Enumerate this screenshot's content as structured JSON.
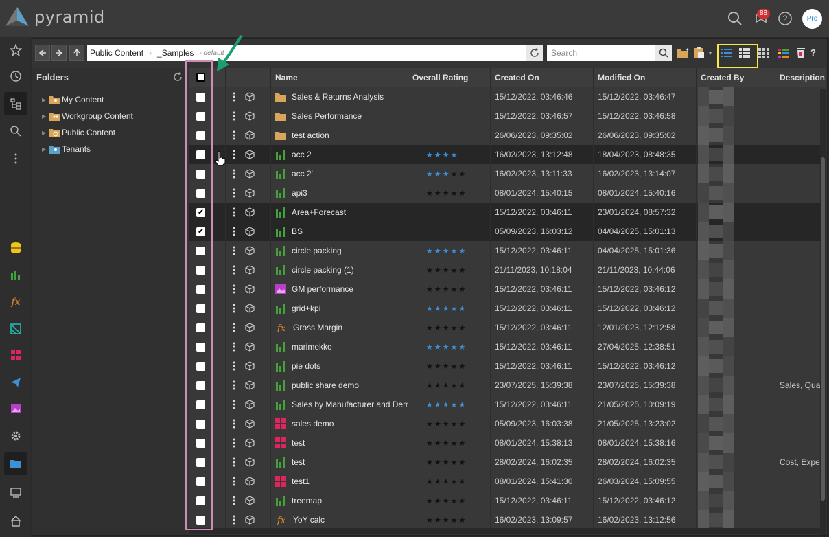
{
  "app": {
    "brand": "pyramid",
    "notification_count": "88",
    "avatar_label": "Pro"
  },
  "toolbar": {
    "path_root": "Public Content",
    "path_current": "_Samples",
    "path_suffix": "- default",
    "search_placeholder": "Search"
  },
  "folders": {
    "title": "Folders",
    "items": [
      {
        "label": "My Content"
      },
      {
        "label": "Workgroup Content"
      },
      {
        "label": "Public Content"
      },
      {
        "label": "Tenants"
      }
    ]
  },
  "grid": {
    "headers": {
      "name": "Name",
      "rating": "Overall Rating",
      "created": "Created On",
      "modified": "Modified On",
      "created_by": "Created By",
      "description": "Description"
    },
    "rows": [
      {
        "icon": "folder",
        "name": "Sales & Returns Analysis",
        "rating": null,
        "created": "15/12/2022, 03:46:46",
        "modified": "15/12/2022, 03:46:47",
        "description": "",
        "checked": false,
        "selected": false
      },
      {
        "icon": "folder",
        "name": "Sales Performance",
        "rating": null,
        "created": "15/12/2022, 03:46:57",
        "modified": "15/12/2022, 03:46:58",
        "description": "",
        "checked": false,
        "selected": false
      },
      {
        "icon": "folder",
        "name": "test action",
        "rating": null,
        "created": "26/06/2023, 09:35:02",
        "modified": "26/06/2023, 09:35:02",
        "description": "",
        "checked": false,
        "selected": false
      },
      {
        "icon": "chart",
        "name": "acc 2",
        "rating": 4,
        "max": 4,
        "created": "16/02/2023, 13:12:48",
        "modified": "18/04/2023, 08:48:35",
        "description": "",
        "checked": false,
        "selected": true
      },
      {
        "icon": "chart",
        "name": "acc 2'",
        "rating": 3,
        "max": 5,
        "created": "16/02/2023, 13:11:33",
        "modified": "16/02/2023, 13:14:07",
        "description": "",
        "checked": false,
        "selected": false
      },
      {
        "icon": "chart",
        "name": "api3",
        "rating": 0,
        "max": 5,
        "created": "08/01/2024, 15:40:15",
        "modified": "08/01/2024, 15:40:16",
        "description": "",
        "checked": false,
        "selected": false
      },
      {
        "icon": "chart",
        "name": "Area+Forecast",
        "rating": null,
        "created": "15/12/2022, 03:46:11",
        "modified": "23/01/2024, 08:57:32",
        "description": "",
        "checked": true,
        "selected": true
      },
      {
        "icon": "chart",
        "name": "BS",
        "rating": null,
        "created": "05/09/2023, 16:03:12",
        "modified": "04/04/2025, 15:01:13",
        "description": "",
        "checked": true,
        "selected": true
      },
      {
        "icon": "chart",
        "name": "circle packing",
        "rating": 5,
        "max": 5,
        "created": "15/12/2022, 03:46:11",
        "modified": "04/04/2025, 15:01:36",
        "description": "",
        "checked": false,
        "selected": false
      },
      {
        "icon": "chart",
        "name": "circle packing (1)",
        "rating": 0,
        "max": 5,
        "created": "21/11/2023, 10:18:04",
        "modified": "21/11/2023, 10:44:06",
        "description": "",
        "checked": false,
        "selected": false
      },
      {
        "icon": "image",
        "name": "GM performance",
        "rating": 0,
        "max": 5,
        "created": "15/12/2022, 03:46:11",
        "modified": "15/12/2022, 03:46:12",
        "description": "",
        "checked": false,
        "selected": false
      },
      {
        "icon": "chart",
        "name": "grid+kpi",
        "rating": 5,
        "max": 5,
        "created": "15/12/2022, 03:46:11",
        "modified": "15/12/2022, 03:46:12",
        "description": "",
        "checked": false,
        "selected": false
      },
      {
        "icon": "fx",
        "name": "Gross Margin",
        "rating": 0,
        "max": 5,
        "created": "15/12/2022, 03:46:11",
        "modified": "12/01/2023, 12:12:58",
        "description": "",
        "checked": false,
        "selected": false
      },
      {
        "icon": "chart",
        "name": "marimekko",
        "rating": 5,
        "max": 5,
        "created": "15/12/2022, 03:46:11",
        "modified": "27/04/2025, 12:38:51",
        "description": "",
        "checked": false,
        "selected": false
      },
      {
        "icon": "chart",
        "name": "pie dots",
        "rating": 0,
        "max": 5,
        "created": "15/12/2022, 03:46:11",
        "modified": "15/12/2022, 03:46:12",
        "description": "",
        "checked": false,
        "selected": false
      },
      {
        "icon": "chart",
        "name": "public share demo",
        "rating": 0,
        "max": 5,
        "created": "23/07/2025, 15:39:38",
        "modified": "23/07/2025, 15:39:38",
        "description": "Sales, Quar",
        "checked": false,
        "selected": false
      },
      {
        "icon": "chart",
        "name": "Sales by Manufacturer and Dem",
        "rating": 5,
        "max": 5,
        "created": "15/12/2022, 03:46:11",
        "modified": "21/05/2025, 10:09:19",
        "description": "",
        "checked": false,
        "selected": false
      },
      {
        "icon": "dashboard",
        "name": "sales demo",
        "rating": 0,
        "max": 5,
        "created": "05/09/2023, 16:03:38",
        "modified": "21/05/2025, 13:23:02",
        "description": "",
        "checked": false,
        "selected": false
      },
      {
        "icon": "dashboard",
        "name": "test",
        "rating": 0,
        "max": 5,
        "created": "08/01/2024, 15:38:13",
        "modified": "08/01/2024, 15:38:16",
        "description": "",
        "checked": false,
        "selected": false
      },
      {
        "icon": "chart",
        "name": "test",
        "rating": 0,
        "max": 5,
        "created": "28/02/2024, 16:02:35",
        "modified": "28/02/2024, 16:02:35",
        "description": "Cost, Exper",
        "checked": false,
        "selected": false
      },
      {
        "icon": "dashboard",
        "name": "test1",
        "rating": 0,
        "max": 5,
        "created": "08/01/2024, 15:41:30",
        "modified": "26/03/2024, 15:09:55",
        "description": "",
        "checked": false,
        "selected": false
      },
      {
        "icon": "chart",
        "name": "treemap",
        "rating": 0,
        "max": 5,
        "created": "15/12/2022, 03:46:11",
        "modified": "15/12/2022, 03:46:12",
        "description": "",
        "checked": false,
        "selected": false
      },
      {
        "icon": "fx",
        "name": "YoY calc",
        "rating": 0,
        "max": 5,
        "created": "16/02/2023, 13:09:57",
        "modified": "16/02/2023, 13:12:56",
        "description": "",
        "checked": false,
        "selected": false
      }
    ]
  },
  "colors": {
    "accent": "#3d8fd6",
    "chart_green": "#43a33a",
    "folder": "#d9a55a",
    "dashboard": "#e0245e",
    "highlight_yellow": "#f5e94b",
    "annotation_pink": "#d08bb6",
    "annotation_arrow": "#1aa06d"
  }
}
